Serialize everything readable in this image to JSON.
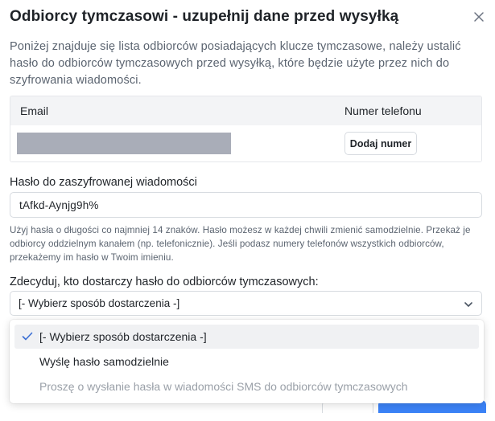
{
  "dialog": {
    "title": "Odbiorcy tymczasowi - uzupełnij dane przed wysyłką",
    "close_icon": "close-icon",
    "intro": "Poniżej znajduje się lista odbiorców posiadających klucze tymczasowe, należy ustalić hasło do odbiorców tymczasowych przed wysyłką, które będzie użyte przez nich do szyfrowania wiadomości."
  },
  "recipients_table": {
    "columns": [
      "Email",
      "Numer telefonu"
    ],
    "rows": [
      {
        "email": "",
        "add_number_label": "Dodaj numer"
      }
    ]
  },
  "password": {
    "label": "Hasło do zaszyfrowanej wiadomości",
    "value": "tAfkd-Aynjg9h%",
    "hint": "Użyj hasła o długości co najmniej 14 znaków. Hasło możesz w każdej chwili zmienić samodzielnie. Przekaż je odbiorcy oddzielnym kanałem (np. telefonicznie). Jeśli podasz numery telefonów wszystkich odbiorców, przekażemy im hasło w Twoim imieniu."
  },
  "delivery": {
    "label": "Zdecyduj, kto dostarczy hasło do odbiorców tymczasowych:",
    "selected": "[- Wybierz sposób dostarczenia -]",
    "options": [
      {
        "label": "[- Wybierz sposób dostarczenia -]",
        "state": "selected"
      },
      {
        "label": "Wyślę hasło samodzielnie",
        "state": "enabled"
      },
      {
        "label": "Proszę o wysłanie hasła w wiadomości SMS do odbiorców tymczasowych",
        "state": "disabled"
      }
    ]
  },
  "colors": {
    "accent": "#3b82f6",
    "check": "#3b6fd4",
    "redaction": "#a9adb8",
    "muted_text": "#5b6470",
    "disabled_text": "#9aa0a8"
  }
}
